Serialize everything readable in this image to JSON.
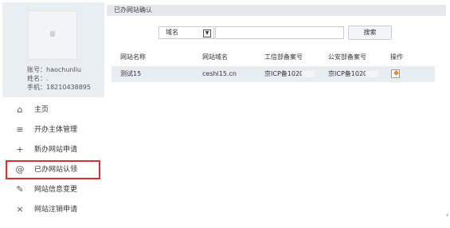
{
  "profile": {
    "account": "账号：haochunliu",
    "name": "姓名：.",
    "phone": "手机：18210438895"
  },
  "menu": [
    {
      "icon": "home-icon",
      "glyph": "⌂",
      "label": "主页",
      "active": false
    },
    {
      "icon": "list-icon",
      "glyph": "≡",
      "label": "开办主体管理",
      "active": false
    },
    {
      "icon": "plus-icon",
      "glyph": "+",
      "label": "新办网站申请",
      "active": false
    },
    {
      "icon": "at-icon",
      "glyph": "@",
      "label": "已办网站认领",
      "active": true
    },
    {
      "icon": "edit-icon",
      "glyph": "✎",
      "label": "网站信息变更",
      "active": false
    },
    {
      "icon": "close-icon",
      "glyph": "×",
      "label": "网站注销申请",
      "active": false
    }
  ],
  "main": {
    "title": "已办网站确认",
    "search": {
      "select_value": "域名",
      "input_value": "",
      "button_label": "搜索"
    },
    "table": {
      "headers": [
        "网站名称",
        "网站域名",
        "工信部备案号",
        "公安部备案号",
        "操作"
      ],
      "rows": [
        {
          "name": "测试15",
          "domain": "ceshi15.cn",
          "miit": "京ICP备1020",
          "mps": "京ICP备1020",
          "action_icon": "edit-icon"
        }
      ]
    }
  }
}
